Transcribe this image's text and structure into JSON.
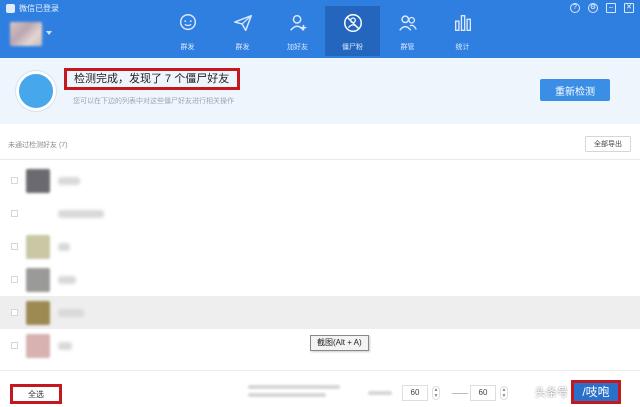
{
  "app": {
    "window_title": "微信已登录",
    "nav": [
      {
        "label": "群发",
        "icon": "chat-bubble-icon",
        "active": false
      },
      {
        "label": "群发",
        "icon": "send-icon",
        "active": false
      },
      {
        "label": "加好友",
        "icon": "add-friend-icon",
        "active": false
      },
      {
        "label": "僵尸粉",
        "icon": "zombie-fan-icon",
        "active": true
      },
      {
        "label": "群管",
        "icon": "group-icon",
        "active": false
      },
      {
        "label": "统计",
        "icon": "bar-chart-icon",
        "active": false
      }
    ],
    "window_controls": [
      "?",
      "⚙",
      "–",
      "✕"
    ]
  },
  "result": {
    "headline": "检测完成，发现了 7 个僵尸好友",
    "subtext": "您可以在下边的列表中对这些僵尸好友进行相关操作",
    "recheck_label": "重新检测"
  },
  "list": {
    "caption": "未通过检测好友 (7)",
    "export_label": "全部导出",
    "rows": [
      {
        "avatar_color": "#6a6a70",
        "name_width": 22,
        "highlight": false
      },
      {
        "avatar_color": "",
        "name_width": 46,
        "highlight": false
      },
      {
        "avatar_color": "#c9c7a4",
        "name_width": 12,
        "highlight": false
      },
      {
        "avatar_color": "#9a9a98",
        "name_width": 18,
        "highlight": false
      },
      {
        "avatar_color": "#9d8a52",
        "name_width": 26,
        "highlight": true
      },
      {
        "avatar_color": "#d7b2b0",
        "name_width": 14,
        "highlight": false
      }
    ]
  },
  "tooltip": "截图(Alt + A)",
  "footer": {
    "select_all_label": "全选",
    "interval_min": "60",
    "interval_max": "60"
  },
  "watermark": {
    "prefix": "头条号",
    "name": "/吱咆"
  },
  "colors": {
    "brand_blue": "#2f7fe0",
    "highlight_red": "#c4181f",
    "button_blue": "#3a8ee6"
  }
}
